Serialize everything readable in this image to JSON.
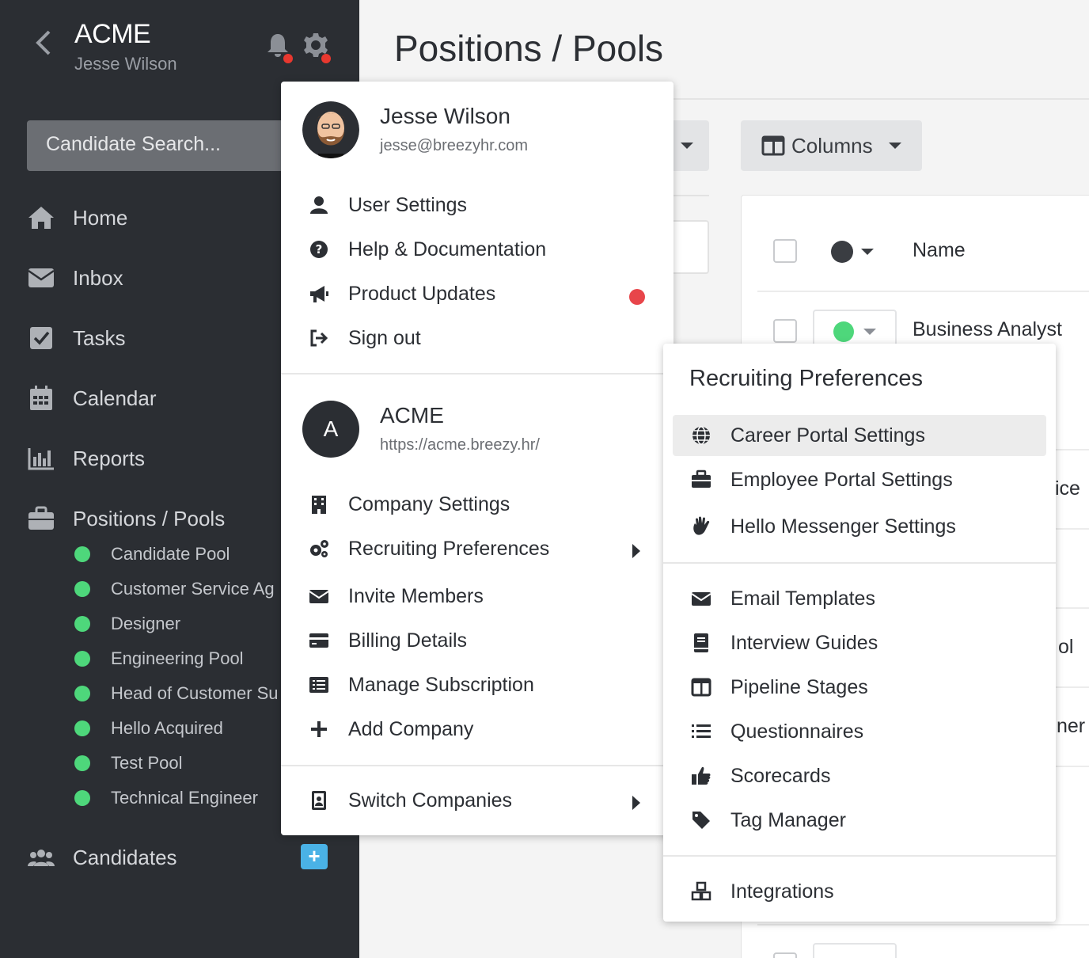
{
  "sidebar": {
    "company": "ACME",
    "user": "Jesse Wilson",
    "search_placeholder": "Candidate Search...",
    "nav": {
      "home": "Home",
      "inbox": "Inbox",
      "tasks": "Tasks",
      "calendar": "Calendar",
      "reports": "Reports",
      "positions": "Positions / Pools",
      "candidates": "Candidates"
    },
    "pools": [
      "Candidate Pool",
      "Customer Service Ag",
      "Designer",
      "Engineering Pool",
      "Head of Customer Su",
      "Hello Acquired",
      "Test Pool",
      "Technical Engineer"
    ],
    "add_label": "+"
  },
  "main": {
    "title": "Positions / Pools",
    "columns_label": "Columns",
    "table": {
      "header_name": "Name",
      "row1_name": "Business Analyst",
      "partial_rows": [
        "ice",
        "ol",
        "ner"
      ]
    }
  },
  "user_menu": {
    "user_name": "Jesse Wilson",
    "user_email": "jesse@breezyhr.com",
    "items": {
      "user_settings": "User Settings",
      "help": "Help & Documentation",
      "updates": "Product Updates",
      "sign_out": "Sign out"
    },
    "company_letter": "A",
    "company_name": "ACME",
    "company_url": "https://acme.breezy.hr/",
    "company_items": {
      "company_settings": "Company Settings",
      "recruiting_prefs": "Recruiting Preferences",
      "invite": "Invite Members",
      "billing": "Billing Details",
      "subscription": "Manage Subscription",
      "add_company": "Add Company"
    },
    "switch": "Switch Companies"
  },
  "recruiting_menu": {
    "title": "Recruiting Preferences",
    "items": {
      "career_portal": "Career Portal Settings",
      "employee_portal": "Employee Portal Settings",
      "hello_messenger": "Hello Messenger Settings",
      "email_templates": "Email Templates",
      "interview_guides": "Interview Guides",
      "pipeline_stages": "Pipeline Stages",
      "questionnaires": "Questionnaires",
      "scorecards": "Scorecards",
      "tag_manager": "Tag Manager",
      "integrations": "Integrations"
    }
  },
  "colors": {
    "sidebar_bg": "#2b2e33",
    "status_green": "#4ed77b",
    "notification_red": "#e8382f",
    "accent_blue": "#4ab2e6"
  }
}
